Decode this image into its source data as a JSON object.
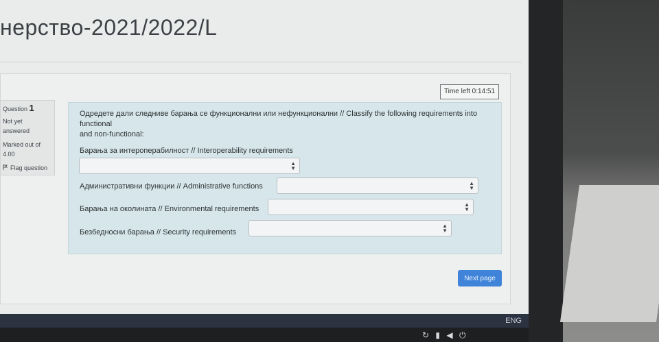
{
  "course": {
    "title": "нерство-2021/2022/L"
  },
  "timer": {
    "text": "Time left 0:14:51"
  },
  "question_info": {
    "number_label": "Question",
    "number": "1",
    "state": "Not yet answered",
    "grade": "Marked out of 4.00",
    "flag_label": "Flag question"
  },
  "question": {
    "prompt_line1": "Одредете дали следниве барања се функционални или нефункционални // Classify the following requirements into functional",
    "prompt_line2": "and non-functional:",
    "rows": [
      {
        "label": "Барања за интероперабилност // Interoperability requirements",
        "value": ""
      },
      {
        "label": "Административни функции // Administrative functions",
        "value": ""
      },
      {
        "label": "Барања на околината // Environmental requirements",
        "value": ""
      },
      {
        "label": "Безбедносни барања // Security requirements",
        "value": ""
      }
    ]
  },
  "navigation": {
    "next_label": "Next page"
  },
  "taskbar": {
    "language": "ENG"
  }
}
